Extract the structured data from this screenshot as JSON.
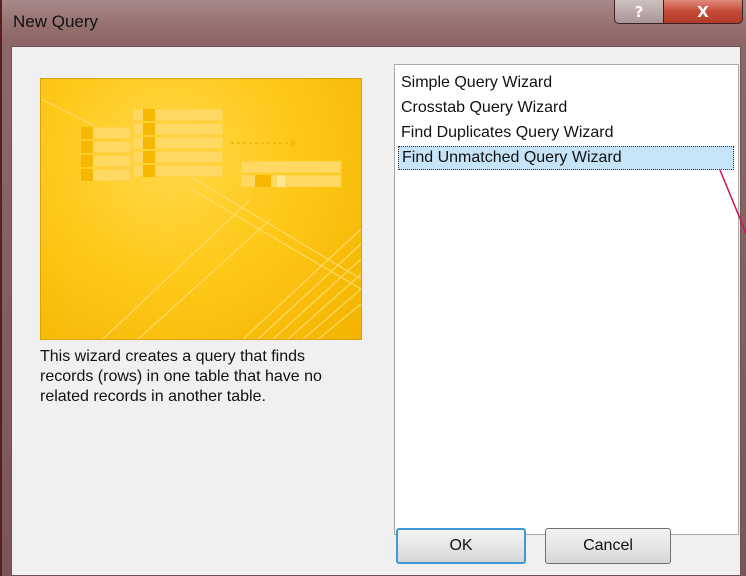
{
  "window": {
    "title": "New Query",
    "help_label": "?",
    "close_label": "X"
  },
  "description": "This wizard creates a query that finds records (rows) in one table that have no related records in another table.",
  "wizards": [
    {
      "label": "Simple Query Wizard",
      "selected": false
    },
    {
      "label": "Crosstab Query Wizard",
      "selected": false
    },
    {
      "label": "Find Duplicates Query Wizard",
      "selected": false
    },
    {
      "label": "Find Unmatched Query Wizard",
      "selected": true
    }
  ],
  "buttons": {
    "ok_label": "OK",
    "cancel_label": "Cancel"
  },
  "colors": {
    "selection": "#c6e3f7",
    "illustration": "#ffc91a",
    "default_button_border": "#3c9ad6",
    "annotation_line": "#d01060"
  }
}
